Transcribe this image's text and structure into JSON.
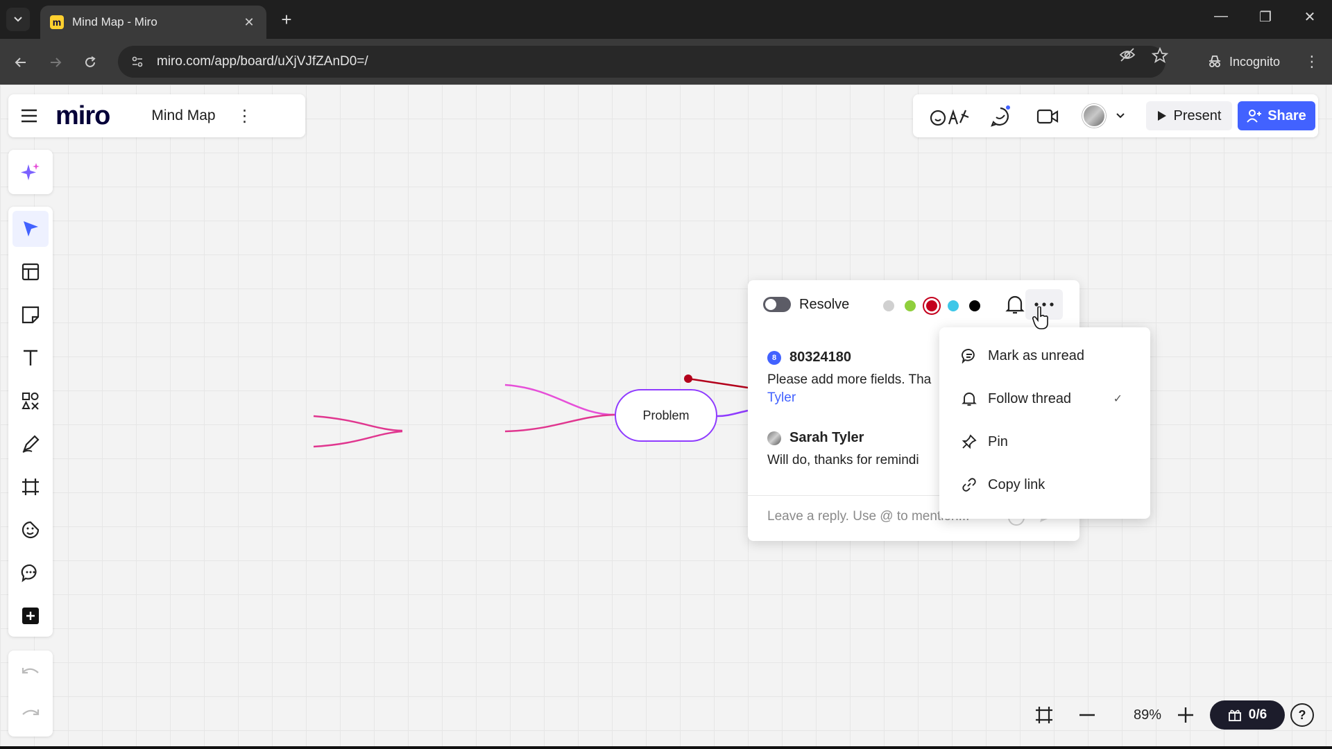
{
  "browser": {
    "tab_title": "Mind Map - Miro",
    "tab_favicon": "m",
    "url": "miro.com/app/board/uXjVJfZAnD0=/",
    "incognito_label": "Incognito"
  },
  "board": {
    "logo": "miro",
    "title": "Mind Map"
  },
  "header_actions": {
    "present_label": "Present",
    "share_label": "Share"
  },
  "rail": {
    "icons": [
      "sparkle-ai-icon",
      "select-arrow-icon",
      "templates-icon",
      "sticky-note-icon",
      "text-icon",
      "shapes-icon",
      "pen-icon",
      "frame-icon",
      "stickers-icon",
      "comment-icon",
      "more-apps-icon",
      "undo-icon",
      "redo-icon"
    ]
  },
  "mindmap": {
    "node_label": "Problem",
    "colors": {
      "pink": "#e0368f",
      "magenta": "#e64fd8",
      "purple": "#8f3bff",
      "red": "#b3001b"
    }
  },
  "comment": {
    "resolve_label": "Resolve",
    "colors": [
      "#d0d0d0",
      "#8fcf3c",
      "#c4001d",
      "#3ec7e8",
      "#000000"
    ],
    "messages": [
      {
        "author": "80324180",
        "badge": "8",
        "text": "Please add more fields. Tha",
        "mention": "Tyler"
      },
      {
        "author": "Sarah Tyler",
        "text": "Will do, thanks for remindi"
      }
    ],
    "reply_placeholder": "Leave a reply. Use @ to mention..."
  },
  "menu": {
    "items": [
      {
        "label": "Mark as unread",
        "icon": "mark-unread-icon",
        "checked": false
      },
      {
        "label": "Follow thread",
        "icon": "bell-icon",
        "checked": true
      },
      {
        "label": "Pin",
        "icon": "pin-icon",
        "checked": false
      },
      {
        "label": "Copy link",
        "icon": "link-icon",
        "checked": false
      }
    ],
    "check_mark": "✓"
  },
  "zoom": {
    "level": "89%",
    "board_count": "0/6"
  }
}
